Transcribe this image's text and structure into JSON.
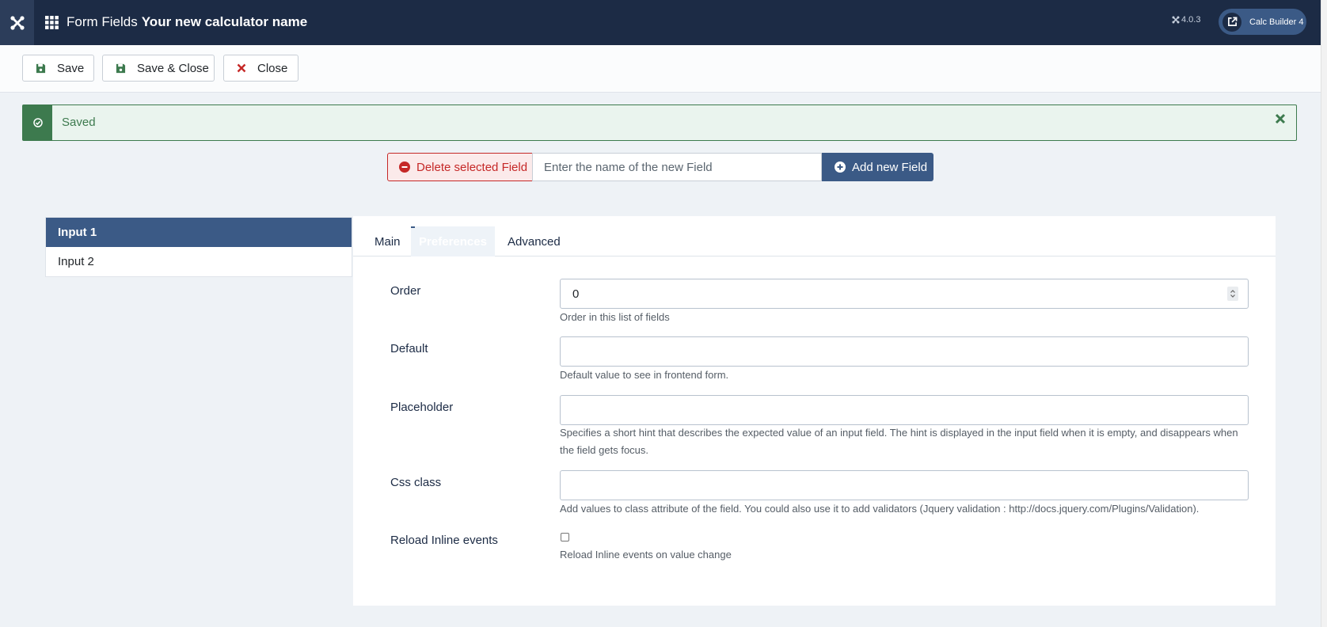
{
  "header": {
    "title_prefix": "Form Fields",
    "title_main": "Your new calculator name",
    "version": "4.0.3",
    "calc_builder_label": "Calc Builder 4",
    "icons": [
      "joomla-logo-icon",
      "grid-icon",
      "joomla-small-icon",
      "external-link-icon"
    ]
  },
  "toolbar": {
    "save_label": "Save",
    "save_close_label": "Save & Close",
    "close_label": "Close"
  },
  "alert": {
    "message": "Saved"
  },
  "field_actions": {
    "delete_label": "Delete selected Field",
    "name_placeholder": "Enter the name of the new Field",
    "add_label": "Add new Field"
  },
  "fields_list": {
    "items": [
      {
        "label": "Input 1",
        "active": true
      },
      {
        "label": "Input 2",
        "active": false
      }
    ]
  },
  "tabs": {
    "main": "Main",
    "preferences": "Preferences",
    "advanced": "Advanced",
    "active": "Preferences"
  },
  "form": {
    "order": {
      "label": "Order",
      "value": "0",
      "hint": "Order in this list of fields"
    },
    "default": {
      "label": "Default",
      "value": "",
      "hint": "Default value to see in frontend form."
    },
    "placeholder": {
      "label": "Placeholder",
      "value": "",
      "hint": "Specifies a short hint that describes the expected value of an input field. The hint is displayed in the input field when it is empty, and disappears when the field gets focus."
    },
    "css_class": {
      "label": "Css class",
      "value": "",
      "hint": "Add values to class attribute of the field. You could also use it to add validators (Jquery validation : http://docs.jquery.com/Plugins/Validation)."
    },
    "reload_inline": {
      "label": "Reload Inline events",
      "checked": false,
      "hint": "Reload Inline events on value change"
    }
  },
  "colors": {
    "header_bg": "#1c2b45",
    "accent": "#3b5a86",
    "success": "#3d7a4e",
    "danger": "#c52827"
  }
}
